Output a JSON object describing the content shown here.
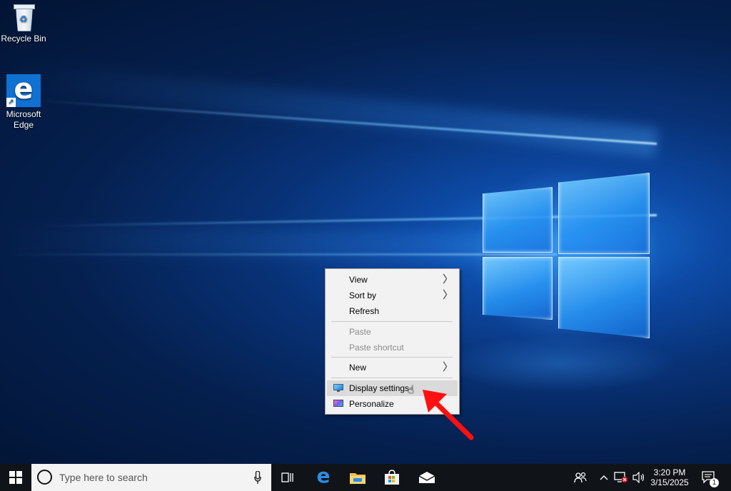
{
  "desktop": {
    "icons": [
      {
        "label": "Recycle Bin"
      },
      {
        "label": "Microsoft Edge"
      }
    ]
  },
  "context_menu": {
    "items": [
      {
        "label": "View",
        "submenu": true,
        "enabled": true
      },
      {
        "label": "Sort by",
        "submenu": true,
        "enabled": true
      },
      {
        "label": "Refresh",
        "enabled": true
      },
      {
        "label": "Paste",
        "enabled": false
      },
      {
        "label": "Paste shortcut",
        "enabled": false
      },
      {
        "label": "New",
        "submenu": true,
        "enabled": true
      },
      {
        "label": "Display settings",
        "enabled": true,
        "highlighted": true,
        "icon": "display-icon"
      },
      {
        "label": "Personalize",
        "enabled": true,
        "icon": "personalize-icon"
      }
    ],
    "submenu_glyph": "〉"
  },
  "taskbar": {
    "search_placeholder": "Type here to search",
    "apps": [
      "task-view-icon",
      "edge-icon",
      "file-explorer-icon",
      "store-icon",
      "mail-icon"
    ],
    "clock": {
      "time": "3:20 PM",
      "date": "3/15/2025"
    },
    "notification_count": "1",
    "tray": [
      "people-icon",
      "chevron-up-icon",
      "network-disconnected-icon",
      "volume-icon",
      "action-center-icon"
    ]
  },
  "colors": {
    "taskbar": "#101318",
    "menu_bg": "#f2f2f2",
    "menu_highlight": "#dadada",
    "accent": "#0f71d2",
    "annotation": "#ff1010"
  }
}
